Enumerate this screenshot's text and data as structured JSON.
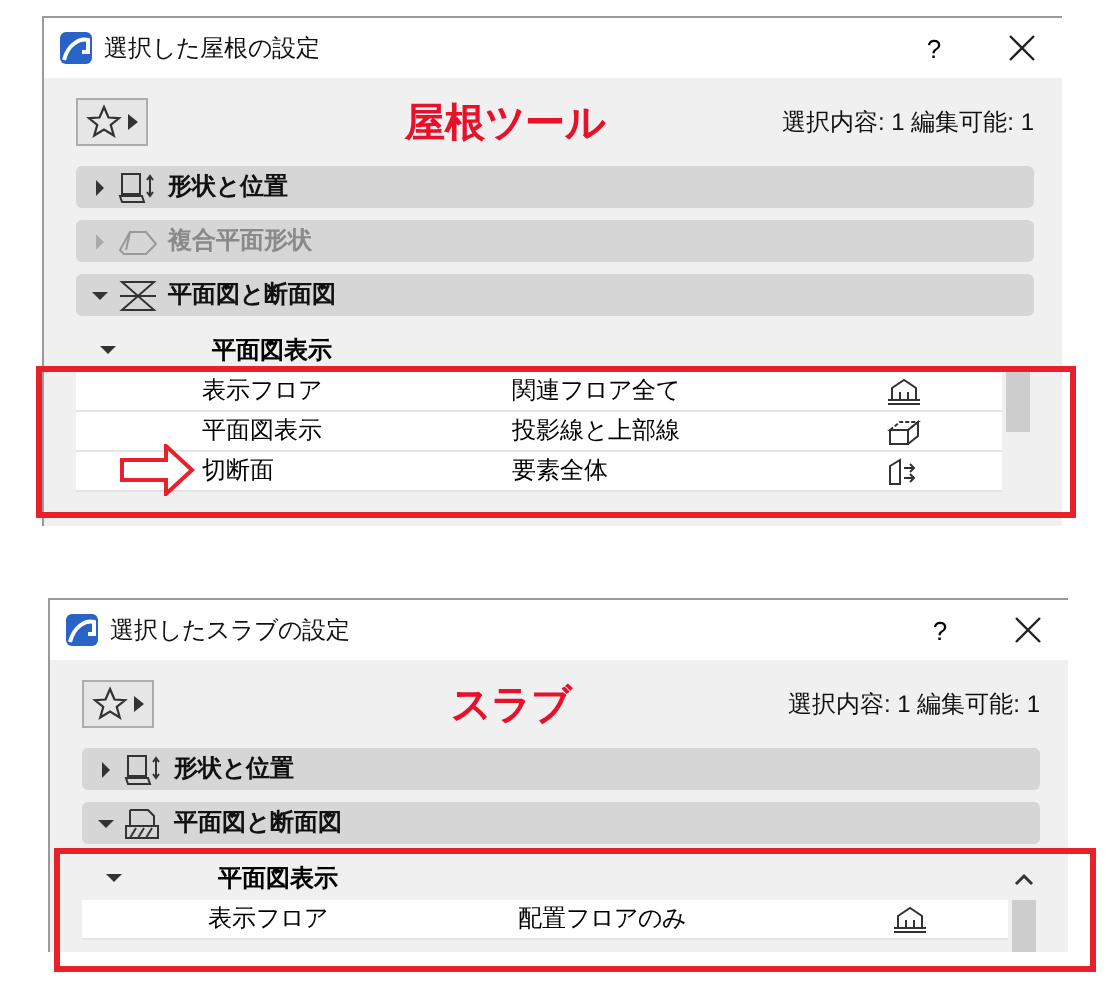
{
  "panels": [
    {
      "title": "選択した屋根の設定",
      "help": "?",
      "tool_label": "屋根ツール",
      "selection_info": "選択内容: 1 編集可能: 1",
      "sections": [
        {
          "label": "形状と位置",
          "kind": "geometry",
          "expanded": false,
          "disabled": false
        },
        {
          "label": "複合平面形状",
          "kind": "complex",
          "expanded": false,
          "disabled": true
        },
        {
          "label": "平面図と断面図",
          "kind": "plan",
          "expanded": true,
          "disabled": false
        }
      ],
      "group": {
        "label": "平面図表示",
        "expanded": true
      },
      "rows": [
        {
          "name": "表示フロア",
          "value": "関連フロア全て",
          "kind": "floor"
        },
        {
          "name": "平面図表示",
          "value": "投影線と上部線",
          "kind": "projection"
        },
        {
          "name": "切断面",
          "value": "要素全体",
          "kind": "cut",
          "pointed": true
        }
      ]
    },
    {
      "title": "選択したスラブの設定",
      "help": "?",
      "tool_label": "スラブ",
      "selection_info": "選択内容: 1 編集可能: 1",
      "sections": [
        {
          "label": "形状と位置",
          "kind": "geometry",
          "expanded": false,
          "disabled": false
        },
        {
          "label": "平面図と断面図",
          "kind": "slabplan",
          "expanded": true,
          "disabled": false
        }
      ],
      "group": {
        "label": "平面図表示",
        "expanded": true
      },
      "rows": [
        {
          "name": "表示フロア",
          "value": "配置フロアのみ",
          "kind": "floor"
        }
      ]
    }
  ]
}
